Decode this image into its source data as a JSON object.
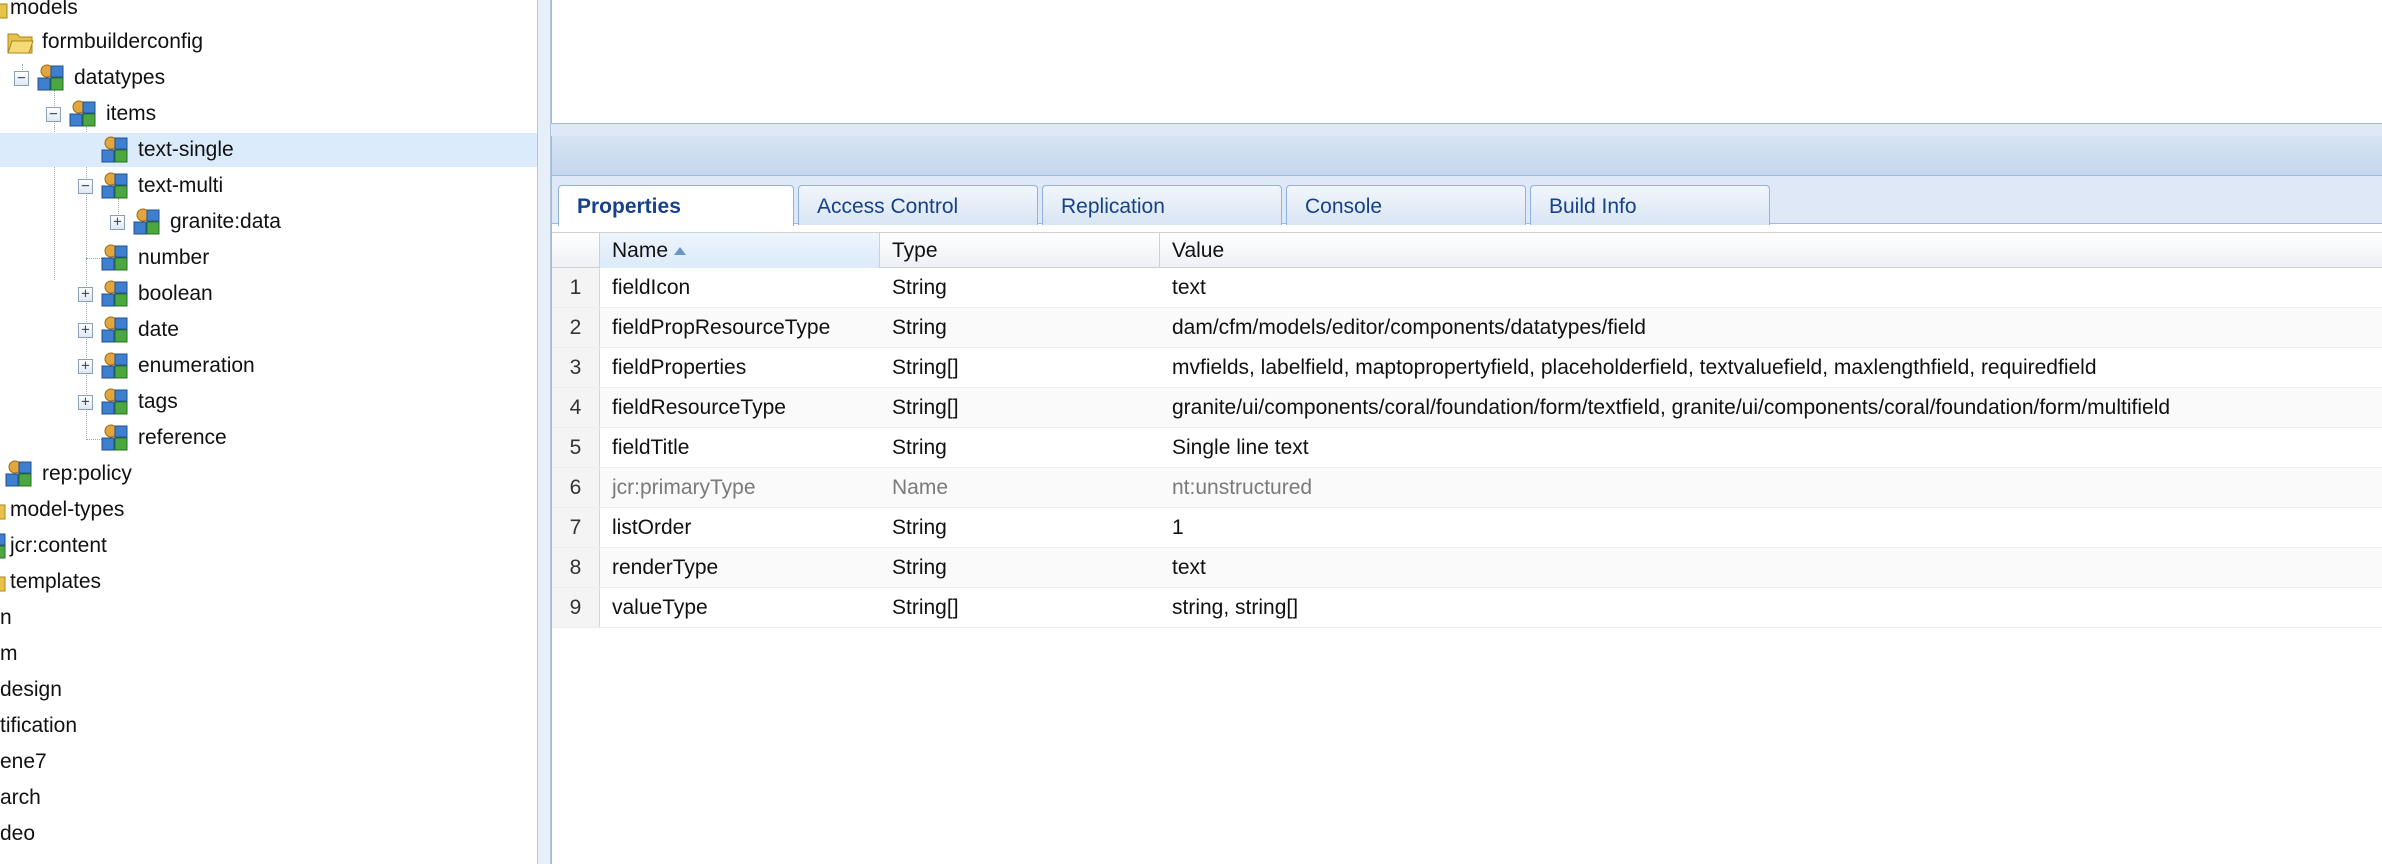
{
  "tree": {
    "nodes": [
      {
        "label": "models",
        "icon": "folder-icon"
      },
      {
        "label": "formbuilderconfig",
        "icon": "folder-icon"
      },
      {
        "label": "datatypes",
        "icon": "node-icon",
        "expander": "⊟"
      },
      {
        "label": "items",
        "icon": "node-icon",
        "expander": "⊟"
      },
      {
        "label": "text-single",
        "icon": "node-icon"
      },
      {
        "label": "text-multi",
        "icon": "node-icon",
        "expander": "⊟"
      },
      {
        "label": "granite:data",
        "icon": "node-icon",
        "expander": "⊞"
      },
      {
        "label": "number",
        "icon": "node-icon"
      },
      {
        "label": "boolean",
        "icon": "node-icon",
        "expander": "⊞"
      },
      {
        "label": "date",
        "icon": "node-icon",
        "expander": "⊞"
      },
      {
        "label": "enumeration",
        "icon": "node-icon",
        "expander": "⊞"
      },
      {
        "label": "tags",
        "icon": "node-icon",
        "expander": "⊞"
      },
      {
        "label": "reference",
        "icon": "node-icon"
      },
      {
        "label": "rep:policy",
        "icon": "node-icon"
      },
      {
        "label": "model-types",
        "icon": "folder-icon"
      },
      {
        "label": "jcr:content",
        "icon": "node-icon"
      },
      {
        "label": "templates",
        "icon": "folder-icon"
      },
      {
        "label": "n",
        "icon": ""
      },
      {
        "label": "m",
        "icon": ""
      },
      {
        "label": "design",
        "icon": ""
      },
      {
        "label": "tification",
        "icon": ""
      },
      {
        "label": "ene7",
        "icon": ""
      },
      {
        "label": "arch",
        "icon": ""
      },
      {
        "label": "deo",
        "icon": ""
      }
    ]
  },
  "tabs": [
    {
      "label": "Properties",
      "active": true
    },
    {
      "label": "Access Control"
    },
    {
      "label": "Replication"
    },
    {
      "label": "Console"
    },
    {
      "label": "Build Info"
    }
  ],
  "grid": {
    "columns": {
      "name": "Name",
      "type": "Type",
      "value": "Value"
    },
    "rows": [
      {
        "n": "1",
        "name": "fieldIcon",
        "type": "String",
        "value": "text"
      },
      {
        "n": "2",
        "name": "fieldPropResourceType",
        "type": "String",
        "value": "dam/cfm/models/editor/components/datatypes/field"
      },
      {
        "n": "3",
        "name": "fieldProperties",
        "type": "String[]",
        "value": "mvfields, labelfield, maptopropertyfield, placeholderfield, textvaluefield, maxlengthfield, requiredfield"
      },
      {
        "n": "4",
        "name": "fieldResourceType",
        "type": "String[]",
        "value": "granite/ui/components/coral/foundation/form/textfield, granite/ui/components/coral/foundation/form/multifield"
      },
      {
        "n": "5",
        "name": "fieldTitle",
        "type": "String",
        "value": "Single line text"
      },
      {
        "n": "6",
        "name": "jcr:primaryType",
        "type": "Name",
        "value": "nt:unstructured"
      },
      {
        "n": "7",
        "name": "listOrder",
        "type": "String",
        "value": "1"
      },
      {
        "n": "8",
        "name": "renderType",
        "type": "String",
        "value": "text"
      },
      {
        "n": "9",
        "name": "valueType",
        "type": "String[]",
        "value": "string, string[]"
      }
    ]
  }
}
